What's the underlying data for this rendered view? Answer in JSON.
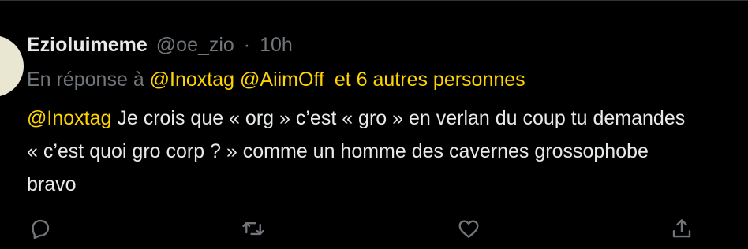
{
  "tweet": {
    "display_name": "Ezioluimeme",
    "handle": "@oe_zio",
    "separator": "·",
    "time": "10h",
    "reply_prefix": "En réponse à",
    "reply_mentions": [
      "@Inoxtag",
      "@AiimOff"
    ],
    "reply_others": "et 6 autres personnes",
    "body_mention": "@Inoxtag",
    "body_line1": "Je crois que « org » c’est « gro » en verlan du coup tu demandes",
    "body_line2": "« c’est quoi gro corp ? » comme un homme des cavernes grossophobe",
    "body_line3": "bravo"
  },
  "actions": [
    {
      "name": "reply",
      "icon": "reply-icon"
    },
    {
      "name": "retweet",
      "icon": "retweet-icon"
    },
    {
      "name": "like",
      "icon": "heart-icon"
    },
    {
      "name": "share",
      "icon": "share-icon"
    }
  ],
  "colors": {
    "background": "#000000",
    "text": "#e7e9ea",
    "secondary": "#71767b",
    "accent": "#ffd400",
    "border": "#2f3336"
  }
}
